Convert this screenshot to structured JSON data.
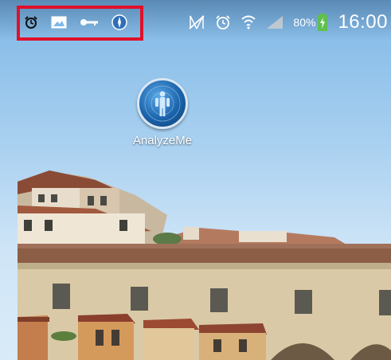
{
  "status_bar": {
    "left_icons": [
      "alarm-icon",
      "image-icon",
      "key-icon",
      "globe-icon"
    ],
    "right_icons": [
      "mute-icon",
      "alarm-icon",
      "wifi-icon",
      "signal-icon",
      "battery-charging-icon"
    ],
    "battery_percent": "80%",
    "time": "16:00",
    "highlight_color": "#e0102a"
  },
  "home_screen": {
    "app_label": "AnalyzeMe",
    "app_icon": "analyzeme-icon"
  }
}
